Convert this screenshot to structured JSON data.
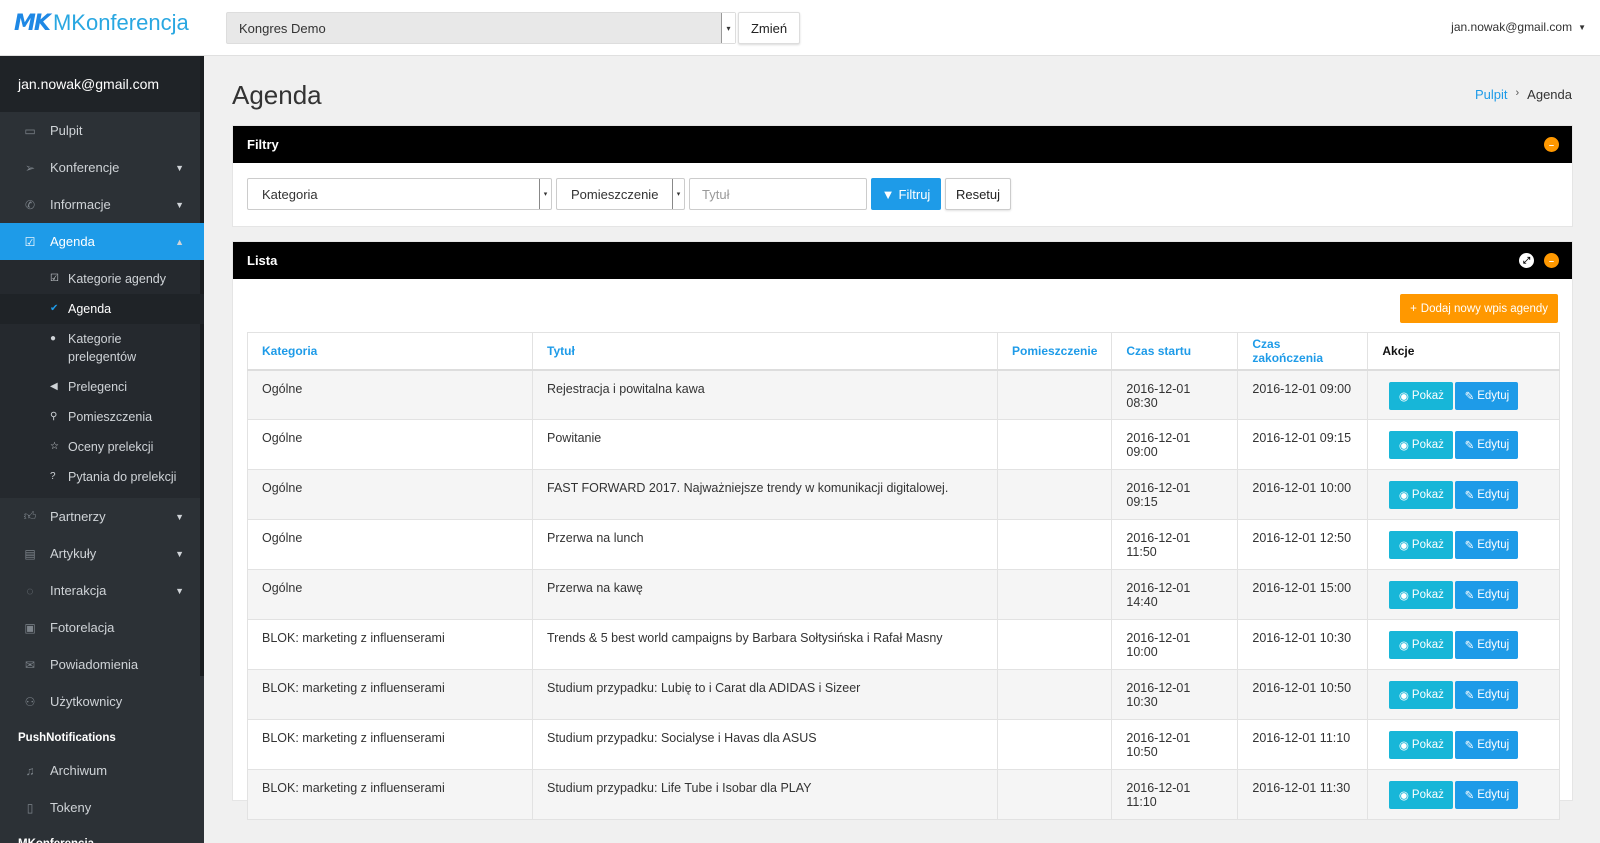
{
  "topbar": {
    "logo_mark": "MK",
    "logo_text": "MKonferencja",
    "conference_select": "Kongres Demo",
    "change_label": "Zmień",
    "user_email": "jan.nowak@gmail.com"
  },
  "sidebar": {
    "user": "jan.nowak@gmail.com",
    "items": [
      {
        "label": "Pulpit",
        "icon": "laptop-icon"
      },
      {
        "label": "Konferencje",
        "icon": "paper-plane-icon"
      },
      {
        "label": "Informacje",
        "icon": "phone-icon"
      },
      {
        "label": "Agenda",
        "icon": "check-square-icon"
      },
      {
        "label": "Partnerzy",
        "icon": "thumbs-up-icon"
      },
      {
        "label": "Artykuły",
        "icon": "file-icon"
      },
      {
        "label": "Interakcja",
        "icon": "comments-icon"
      },
      {
        "label": "Fotorelacja",
        "icon": "image-icon"
      },
      {
        "label": "Powiadomienia",
        "icon": "envelope-icon"
      },
      {
        "label": "Użytkownicy",
        "icon": "users-icon"
      }
    ],
    "agenda_sub": [
      {
        "label": "Kategorie agendy",
        "icon": "check-square-icon"
      },
      {
        "label": "Agenda",
        "icon": "check-icon"
      },
      {
        "label": "Kategorie prelegentów",
        "icon": "tag-icon"
      },
      {
        "label": "Prelegenci",
        "icon": "bullhorn-icon"
      },
      {
        "label": "Pomieszczenia",
        "icon": "map-marker-icon"
      },
      {
        "label": "Oceny prelekcji",
        "icon": "star-half-icon"
      },
      {
        "label": "Pytania do prelekcji",
        "icon": "question-circle-icon"
      }
    ],
    "push_heading": "PushNotifications",
    "push_items": [
      {
        "label": "Archiwum",
        "icon": "bell-icon"
      },
      {
        "label": "Tokeny",
        "icon": "file-icon"
      }
    ],
    "footer_heading": "MKonferencja"
  },
  "page": {
    "title": "Agenda",
    "breadcrumb_home": "Pulpit",
    "breadcrumb_current": "Agenda"
  },
  "filters": {
    "title": "Filtry",
    "category": "Kategoria",
    "room": "Pomieszczenie",
    "title_placeholder": "Tytuł",
    "filter_label": "Filtruj",
    "reset_label": "Resetuj"
  },
  "list": {
    "title": "Lista",
    "add_label": "Dodaj nowy wpis agendy",
    "columns": [
      "Kategoria",
      "Tytuł",
      "Pomieszczenie",
      "Czas startu",
      "Czas zakończenia",
      "Akcje"
    ],
    "show_label": "Pokaż",
    "edit_label": "Edytuj",
    "rows": [
      {
        "category": "Ogólne",
        "title": "Rejestracja i powitalna kawa",
        "room": "",
        "start": "2016-12-01 08:30",
        "end": "2016-12-01 09:00"
      },
      {
        "category": "Ogólne",
        "title": "Powitanie",
        "room": "",
        "start": "2016-12-01 09:00",
        "end": "2016-12-01 09:15"
      },
      {
        "category": "Ogólne",
        "title": "FAST FORWARD 2017. Najważniejsze trendy w komunikacji digitalowej.",
        "room": "",
        "start": "2016-12-01 09:15",
        "end": "2016-12-01 10:00"
      },
      {
        "category": "Ogólne",
        "title": "Przerwa na lunch",
        "room": "",
        "start": "2016-12-01 11:50",
        "end": "2016-12-01 12:50"
      },
      {
        "category": "Ogólne",
        "title": "Przerwa na kawę",
        "room": "",
        "start": "2016-12-01 14:40",
        "end": "2016-12-01 15:00"
      },
      {
        "category": "BLOK: marketing z influenserami",
        "title": "Trends & 5 best world campaigns by Barbara Sołtysińska i Rafał Masny",
        "room": "",
        "start": "2016-12-01 10:00",
        "end": "2016-12-01 10:30"
      },
      {
        "category": "BLOK: marketing z influenserami",
        "title": "Studium przypadku: Lubię to i Carat dla ADIDAS i Sizeer",
        "room": "",
        "start": "2016-12-01 10:30",
        "end": "2016-12-01 10:50"
      },
      {
        "category": "BLOK: marketing z influenserami",
        "title": "Studium przypadku: Socialyse i Havas dla ASUS",
        "room": "",
        "start": "2016-12-01 10:50",
        "end": "2016-12-01 11:10"
      },
      {
        "category": "BLOK: marketing z influenserami",
        "title": "Studium przypadku: Life Tube i Isobar dla PLAY",
        "room": "",
        "start": "2016-12-01 11:10",
        "end": "2016-12-01 11:30"
      }
    ]
  },
  "colors": {
    "accent": "#1e9be8",
    "show_button": "#17b6d8",
    "add_button": "#ff9800",
    "sidebar_bg": "#2c3136"
  }
}
